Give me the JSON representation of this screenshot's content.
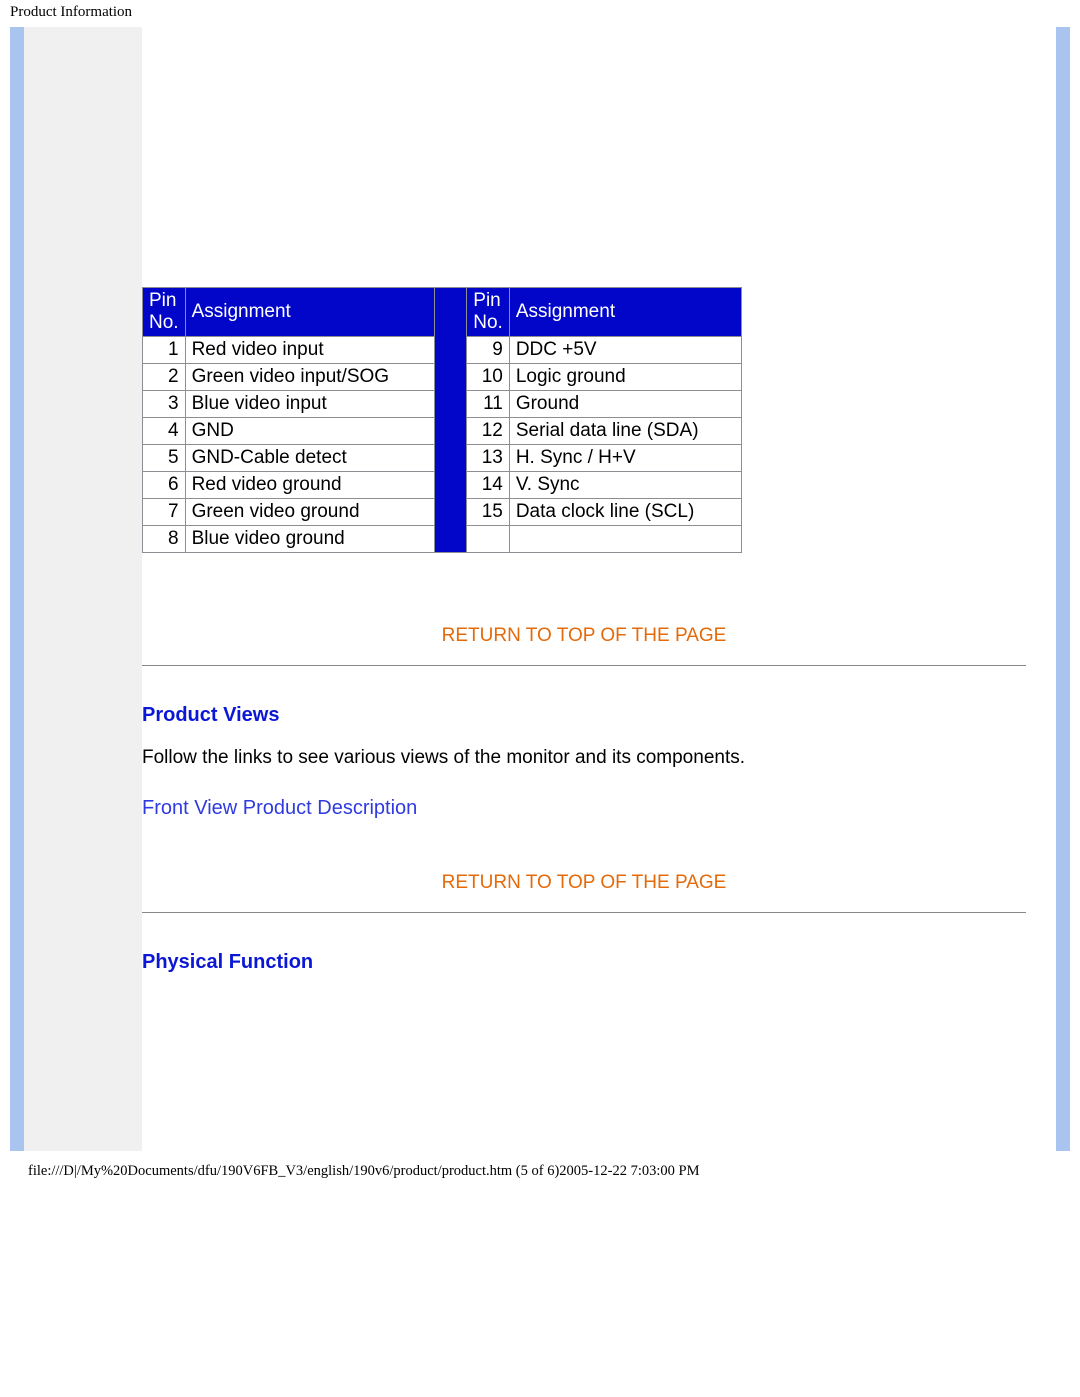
{
  "header_title": "Product Information",
  "pin_table": {
    "col_headers": {
      "pin": "Pin No.",
      "assignment": "Assignment"
    },
    "left": [
      {
        "no": "1",
        "assignment": "Red video input"
      },
      {
        "no": "2",
        "assignment": "Green video input/SOG"
      },
      {
        "no": "3",
        "assignment": "Blue video input"
      },
      {
        "no": "4",
        "assignment": "GND"
      },
      {
        "no": "5",
        "assignment": "GND-Cable detect"
      },
      {
        "no": "6",
        "assignment": "Red video ground"
      },
      {
        "no": "7",
        "assignment": "Green video ground"
      },
      {
        "no": "8",
        "assignment": "Blue video ground"
      }
    ],
    "right": [
      {
        "no": "9",
        "assignment": "DDC +5V"
      },
      {
        "no": "10",
        "assignment": "Logic ground"
      },
      {
        "no": "11",
        "assignment": "Ground"
      },
      {
        "no": "12",
        "assignment": "Serial data line (SDA)"
      },
      {
        "no": "13",
        "assignment": "H. Sync / H+V"
      },
      {
        "no": "14",
        "assignment": "V. Sync"
      },
      {
        "no": "15",
        "assignment": "Data clock line (SCL)"
      },
      {
        "no": "",
        "assignment": ""
      }
    ]
  },
  "return_link_label": "RETURN TO TOP OF THE PAGE",
  "sections": {
    "product_views": {
      "heading": "Product Views",
      "text": "Follow the links to see various views of the monitor and its components.",
      "link_label": "Front View Product Description"
    },
    "physical_function": {
      "heading": "Physical Function"
    }
  },
  "footer_path": "file:///D|/My%20Documents/dfu/190V6FB_V3/english/190v6/product/product.htm (5 of 6)2005-12-22 7:03:00 PM"
}
